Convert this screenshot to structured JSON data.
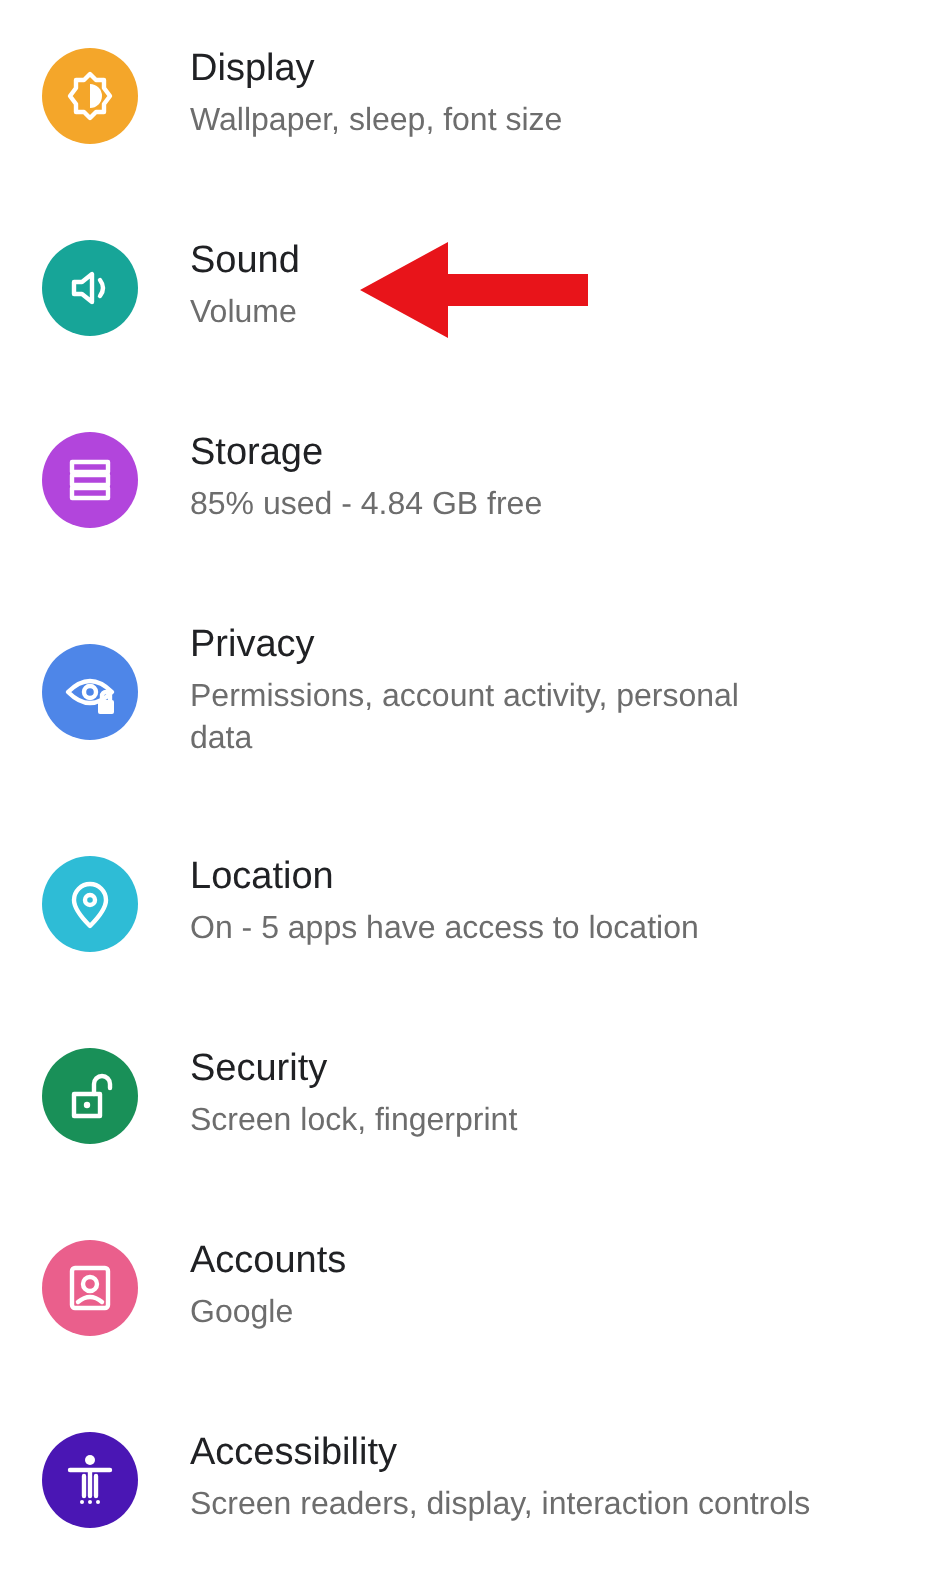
{
  "settings": [
    {
      "kind": "display",
      "color": "#f4a62a",
      "title": "Display",
      "subtitle": "Wallpaper, sleep, font size",
      "pointed_at": false
    },
    {
      "kind": "sound",
      "color": "#17a598",
      "title": "Sound",
      "subtitle": "Volume",
      "pointed_at": true
    },
    {
      "kind": "storage",
      "color": "#b245dc",
      "title": "Storage",
      "subtitle": "85% used - 4.84 GB free",
      "pointed_at": false
    },
    {
      "kind": "privacy",
      "color": "#4e86e8",
      "title": "Privacy",
      "subtitle": "Permissions, account activity, personal data",
      "pointed_at": false
    },
    {
      "kind": "location",
      "color": "#2ebcd6",
      "title": "Location",
      "subtitle": "On - 5 apps have access to location",
      "pointed_at": false
    },
    {
      "kind": "security",
      "color": "#199058",
      "title": "Security",
      "subtitle": "Screen lock, fingerprint",
      "pointed_at": false
    },
    {
      "kind": "accounts",
      "color": "#ea5f8c",
      "title": "Accounts",
      "subtitle": "Google",
      "pointed_at": false
    },
    {
      "kind": "accessibility",
      "color": "#4a16b4",
      "title": "Accessibility",
      "subtitle": "Screen readers, display, interaction controls",
      "pointed_at": false
    }
  ]
}
